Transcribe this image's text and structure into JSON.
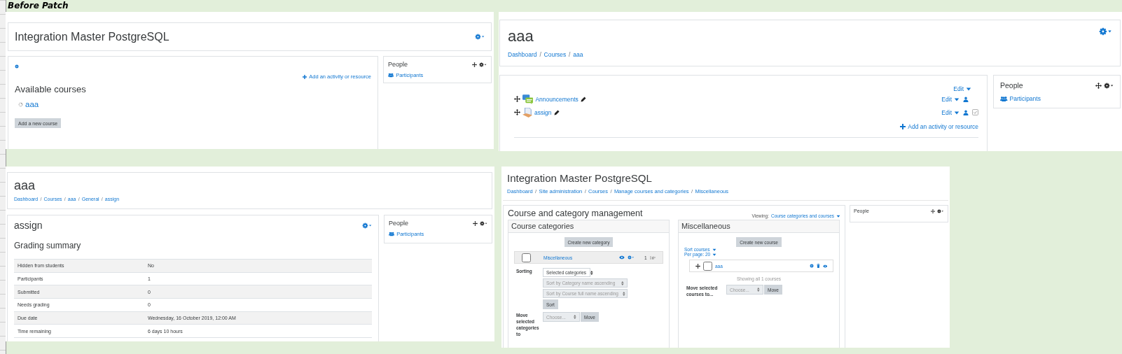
{
  "caption": "Before Patch",
  "screens": [
    {
      "kind": "frontpage",
      "header": {
        "title": "Integration Master PostgreSQL"
      },
      "main": {
        "add_activity": "Add an activity or resource",
        "heading": "Available courses",
        "courses": [
          "aaa"
        ],
        "button": "Add a new course"
      },
      "block": {
        "title": "People",
        "links": [
          "Participants"
        ]
      }
    },
    {
      "kind": "assignment",
      "header": {
        "title": "aaa",
        "breadcrumb": [
          "Dashboard",
          "Courses",
          "aaa",
          "General",
          "assign"
        ],
        "separator": "/"
      },
      "main": {
        "heading": "assign",
        "subheading": "Grading summary",
        "rows": [
          {
            "label": "Hidden from students",
            "value": "No"
          },
          {
            "label": "Participants",
            "value": "1"
          },
          {
            "label": "Submitted",
            "value": "0"
          },
          {
            "label": "Needs grading",
            "value": "0"
          },
          {
            "label": "Due date",
            "value": "Wednesday, 16 October 2019, 12:00 AM"
          },
          {
            "label": "Time remaining",
            "value": "6 days 10 hours"
          }
        ]
      },
      "block": {
        "title": "People",
        "links": [
          "Participants"
        ]
      }
    },
    {
      "kind": "course",
      "header": {
        "title": "aaa",
        "breadcrumb": [
          "Dashboard",
          "Courses",
          "aaa"
        ],
        "separator": "/"
      },
      "main": {
        "section_edit": "Edit",
        "activities": [
          {
            "kind": "forum",
            "name": "Announcements",
            "edit": "Edit",
            "completion": false
          },
          {
            "kind": "assignment",
            "name": "assign",
            "edit": "Edit",
            "completion": true
          }
        ],
        "add_activity": "Add an activity or resource"
      },
      "block": {
        "title": "People",
        "links": [
          "Participants"
        ]
      }
    },
    {
      "kind": "management",
      "header": {
        "title": "Integration Master PostgreSQL",
        "breadcrumb": [
          "Dashboard",
          "Site administration",
          "Courses",
          "Manage courses and categories",
          "Miscellaneous"
        ],
        "separator": "/"
      },
      "main": {
        "heading": "Course and category management",
        "viewing_label": "Viewing:",
        "viewing": "Course categories and courses",
        "categories": {
          "title": "Course categories",
          "button": "Create new category",
          "items": [
            {
              "name": "Miscellaneous",
              "checked": false,
              "count": "1"
            }
          ],
          "sorting_label": "Sorting",
          "selects": [
            {
              "value": "Selected categories",
              "disabled": false
            },
            {
              "value": "Sort by Category name ascending",
              "disabled": true
            },
            {
              "value": "Sort by Course full name ascending",
              "disabled": true
            }
          ],
          "sort_button": "Sort",
          "move_label": "Move selected categories to",
          "move_select": "Choose...",
          "move_button": "Move"
        },
        "courses": {
          "title": "Miscellaneous",
          "button": "Create new course",
          "links": [
            "Sort courses",
            "Per page: 20"
          ],
          "items": [
            {
              "name": "aaa",
              "checked": false
            }
          ],
          "status": "Showing all 1 courses",
          "move_label": "Move selected courses to...",
          "move_select": "Choose...",
          "move_button": "Move"
        }
      },
      "block": {
        "title": "People"
      }
    }
  ]
}
